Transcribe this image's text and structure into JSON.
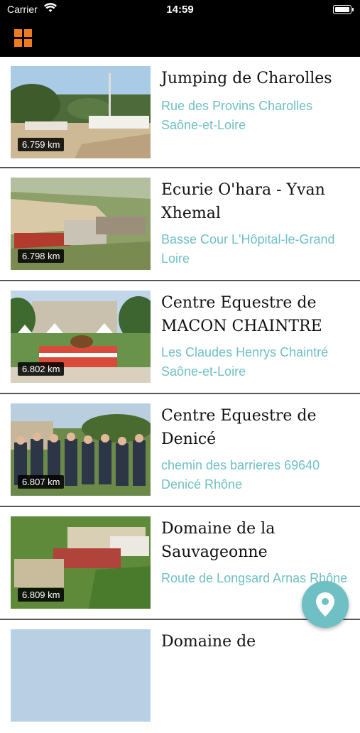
{
  "status": {
    "carrier": "Carrier",
    "time": "14:59"
  },
  "navbar": {
    "menu_icon": "grid-icon"
  },
  "items": [
    {
      "title": "Jumping de Charolles",
      "address": "Rue des Provins Charolles Saône-et-Loire",
      "distance": "6.759 km"
    },
    {
      "title": "Ecurie O'hara - Yvan Xhemal",
      "address": "Basse Cour L'Hôpital-le-Grand Loire",
      "distance": "6.798 km"
    },
    {
      "title": "Centre Equestre de MACON CHAINTRE",
      "address": "Les Claudes Henrys Chaintré Saône-et-Loire",
      "distance": "6.802 km"
    },
    {
      "title": "Centre Equestre de Denicé",
      "address": "chemin des barrieres 69640 Denicé Rhône",
      "distance": "6.807 km"
    },
    {
      "title": "Domaine de la Sauvageonne",
      "address": "Route de Longsard Arnas Rhône",
      "distance": "6.809 km"
    },
    {
      "title": "Domaine de",
      "address": "",
      "distance": ""
    }
  ],
  "fab": {
    "icon": "map-pin-icon",
    "color": "#6fc0c4"
  },
  "colors": {
    "accent": "#f07a1f",
    "link": "#6fc0c4"
  }
}
